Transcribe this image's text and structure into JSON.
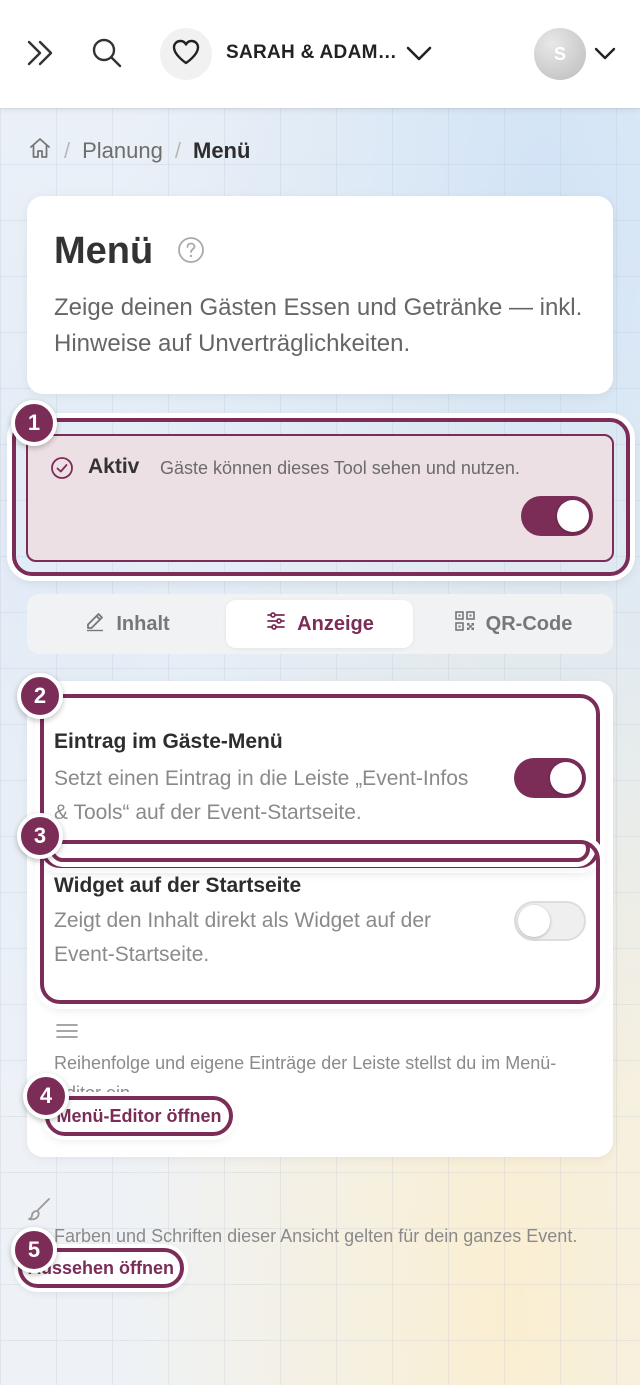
{
  "header": {
    "event_name": "SARAH & ADAM…",
    "avatar_initial": "S",
    "icons": [
      "double-chevron-right-icon",
      "search-icon",
      "heart-icon",
      "chevron-down-icon",
      "avatar",
      "chevron-down-icon"
    ]
  },
  "breadcrumb": {
    "home_icon": "home-icon",
    "separator": "/",
    "items": [
      "Planung",
      "Menü"
    ]
  },
  "page": {
    "title": "Menü",
    "help_icon": "question-circle-icon",
    "description": "Zeige deinen Gästen Essen und Getränke — inkl. Hinweise auf Unverträglichkeiten."
  },
  "active": {
    "label": "Aktiv",
    "description": "Gäste können dieses Tool sehen und nutzen.",
    "enabled": true
  },
  "tabs": [
    {
      "label": "Inhalt",
      "icon": "edit-icon",
      "selected": false
    },
    {
      "label": "Anzeige",
      "icon": "sliders-icon",
      "selected": true
    },
    {
      "label": "QR-Code",
      "icon": "qr-code-icon",
      "selected": false
    }
  ],
  "settings": [
    {
      "title": "Eintrag im Gäste-Menü",
      "description": "Setzt einen Eintrag in die Leiste „Event-Infos & Tools“ auf der Event-Startseite.",
      "enabled": true
    },
    {
      "title": "Widget auf der Startseite",
      "description": "Zeigt den Inhalt direkt als Widget auf der Event-Startseite.",
      "enabled": false
    }
  ],
  "menu_editor": {
    "hint": "Reihenfolge und eigene Einträge der Leiste stellst du im Menü-Editor ein.",
    "button_label": "Menü-Editor öffnen"
  },
  "appearance": {
    "hint": "Farben und Schriften dieser Ansicht gelten für dein ganzes Event.",
    "button_label": "Aussehen öffnen"
  },
  "badges": [
    "1",
    "2",
    "3",
    "4",
    "5"
  ],
  "colors": {
    "accent": "#7b2c57",
    "active_bg": "#ede0e5"
  }
}
